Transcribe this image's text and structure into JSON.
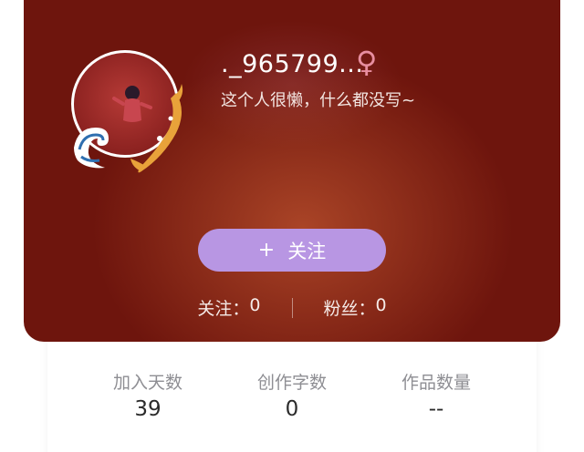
{
  "profile": {
    "username": "._965799...",
    "gender_icon": "female-icon",
    "gender_symbol": "♀",
    "bio": "这个人很懒，什么都没写~"
  },
  "follow": {
    "plus": "+",
    "label": "关注"
  },
  "counts": {
    "following_label": "关注：",
    "following_value": "0",
    "followers_label": "粉丝：",
    "followers_value": "0"
  },
  "stats": [
    {
      "label": "加入天数",
      "value": "39"
    },
    {
      "label": "创作字数",
      "value": "0"
    },
    {
      "label": "作品数量",
      "value": "--"
    }
  ],
  "colors": {
    "header_bg": "#6e150d",
    "follow_button": "#b896e3",
    "gender": "#e88ea0"
  }
}
